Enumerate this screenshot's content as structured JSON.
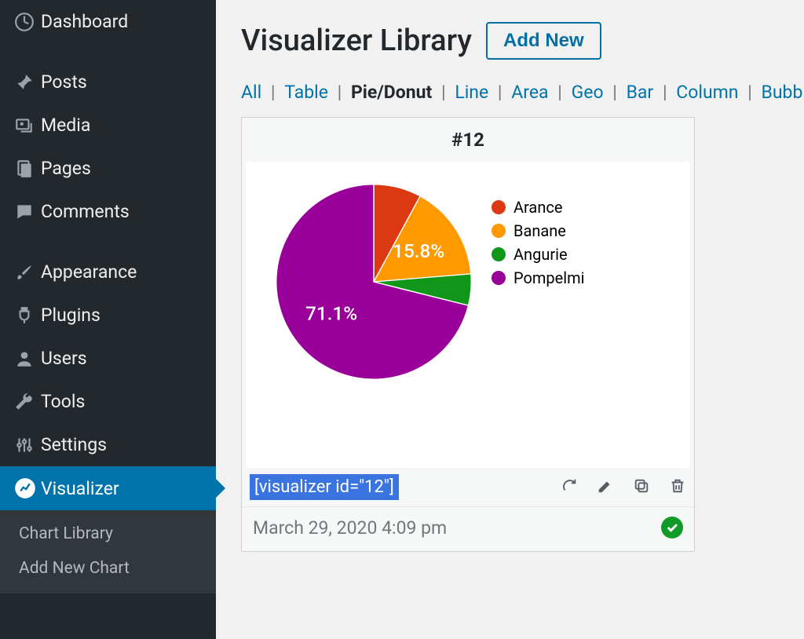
{
  "sidebar": {
    "items": [
      {
        "label": "Dashboard",
        "icon": "dashboard"
      },
      {
        "label": "Posts",
        "icon": "pin"
      },
      {
        "label": "Media",
        "icon": "media"
      },
      {
        "label": "Pages",
        "icon": "pages"
      },
      {
        "label": "Comments",
        "icon": "comment"
      },
      {
        "label": "Appearance",
        "icon": "brush"
      },
      {
        "label": "Plugins",
        "icon": "plug"
      },
      {
        "label": "Users",
        "icon": "user"
      },
      {
        "label": "Tools",
        "icon": "wrench"
      },
      {
        "label": "Settings",
        "icon": "sliders"
      },
      {
        "label": "Visualizer",
        "icon": "chart"
      }
    ],
    "submenu": [
      {
        "label": "Chart Library"
      },
      {
        "label": "Add New Chart"
      }
    ]
  },
  "header": {
    "title": "Visualizer Library",
    "add_new": "Add New"
  },
  "filters": [
    "All",
    "Table",
    "Pie/Donut",
    "Line",
    "Area",
    "Geo",
    "Bar",
    "Column",
    "Bubble"
  ],
  "filters_active_index": 2,
  "card": {
    "title": "#12",
    "shortcode": "[visualizer id=\"12\"]",
    "date": "March 29, 2020 4:09 pm"
  },
  "chart_data": {
    "type": "pie",
    "series": [
      {
        "name": "Arance",
        "value": 7.9,
        "color": "#dc3912"
      },
      {
        "name": "Banane",
        "value": 15.8,
        "color": "#ff9900"
      },
      {
        "name": "Angurie",
        "value": 5.2,
        "color": "#109618"
      },
      {
        "name": "Pompelmi",
        "value": 71.1,
        "color": "#990099"
      }
    ],
    "labels_shown": [
      {
        "name": "Banane",
        "text": "15.8%"
      },
      {
        "name": "Pompelmi",
        "text": "71.1%"
      }
    ]
  },
  "colors": {
    "accent": "#0073aa",
    "link": "#0073aa"
  }
}
